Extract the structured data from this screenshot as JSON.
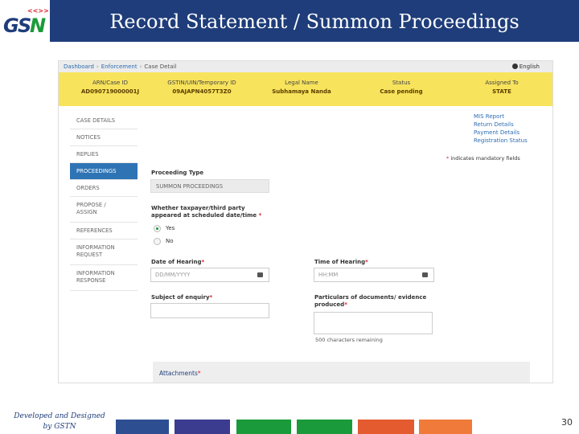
{
  "slide": {
    "title": "Record Statement / Summon Proceedings",
    "logo_text": "GSTN",
    "footer_credit_line1": "Developed and Designed",
    "footer_credit_line2": "by GSTN",
    "page_number": "30",
    "footer_colors": [
      "#2d4f92",
      "#3b3b8f",
      "#1a9a3a",
      "#1a9a3a",
      "#e35b2e",
      "#f07a3a"
    ]
  },
  "breadcrumb": {
    "items": [
      "Dashboard",
      "Enforcement",
      "Case Detail"
    ]
  },
  "language": "English",
  "case_summary": {
    "columns": [
      {
        "header": "ARN/Case ID",
        "value": "AD090719000001J"
      },
      {
        "header": "GSTIN/UIN/Temporary ID",
        "value": "09AJAPN4057T3Z0"
      },
      {
        "header": "Legal Name",
        "value": "Subhamaya Nanda"
      },
      {
        "header": "Status",
        "value": "Case pending"
      },
      {
        "header": "Assigned To",
        "value": "STATE"
      }
    ]
  },
  "sidebar": {
    "items": [
      {
        "label_1": "CASE DETAILS",
        "label_2": ""
      },
      {
        "label_1": "NOTICES",
        "label_2": ""
      },
      {
        "label_1": "REPLIES",
        "label_2": ""
      },
      {
        "label_1": "PROCEEDINGS",
        "label_2": ""
      },
      {
        "label_1": "ORDERS",
        "label_2": ""
      },
      {
        "label_1": "PROPOSE /",
        "label_2": "ASSIGN"
      },
      {
        "label_1": "REFERENCES",
        "label_2": ""
      },
      {
        "label_1": "INFORMATION",
        "label_2": "REQUEST"
      },
      {
        "label_1": "INFORMATION",
        "label_2": "RESPONSE"
      }
    ]
  },
  "quick_links": [
    "MIS Report",
    "Return Details",
    "Payment Details",
    "Registration Status"
  ],
  "mandatory_note": "indicates mandatory fields",
  "form": {
    "proceeding_type_label": "Proceeding Type",
    "proceeding_type_value": "SUMMON PROCEEDINGS",
    "appeared_label_1": "Whether taxpayer/third party",
    "appeared_label_2": "appeared at scheduled date/time",
    "option_yes": "Yes",
    "option_no": "No",
    "date_label": "Date of Hearing",
    "date_placeholder": "DD/MM/YYYY",
    "time_label": "Time of Hearing",
    "time_placeholder": "HH:MM",
    "subject_label": "Subject of enquiry",
    "particulars_label_1": "Particulars of documents/ evidence",
    "particulars_label_2": "produced",
    "chars_remaining": "500 characters remaining",
    "attachments_label": "Attachments"
  }
}
